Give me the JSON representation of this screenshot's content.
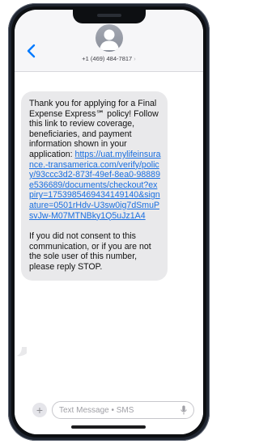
{
  "header": {
    "contact_phone": "+1 (469) 484-7817",
    "chevron": "›",
    "back_icon": "chevron-left-icon",
    "avatar_icon": "person-icon"
  },
  "message": {
    "intro": "Thank you for applying for a Final Expense Express℠ policy! Follow this link to review coverage, beneficiaries, and payment information shown in your application: ",
    "link": "https://uat.mylifeinsurance.-transamerica.com/verify/policy/93ccc3d2-873f-49ef-8ea0-98889e536689/documents/checkout?expiry=1753985469434149140&signature=0501rHdv-U3sw0ig7dSmuPsvJw-M07MTNBky1Q5uJz1A4",
    "outro": "If you did not consent to this communication, or if you are not the sole user of this number, please reply STOP."
  },
  "composer": {
    "placeholder": "Text Message • SMS",
    "plus_label": "+",
    "mic_icon": "microphone-icon"
  },
  "colors": {
    "link": "#1a6fe0",
    "bubble": "#e9e9eb",
    "accent": "#007aff"
  }
}
